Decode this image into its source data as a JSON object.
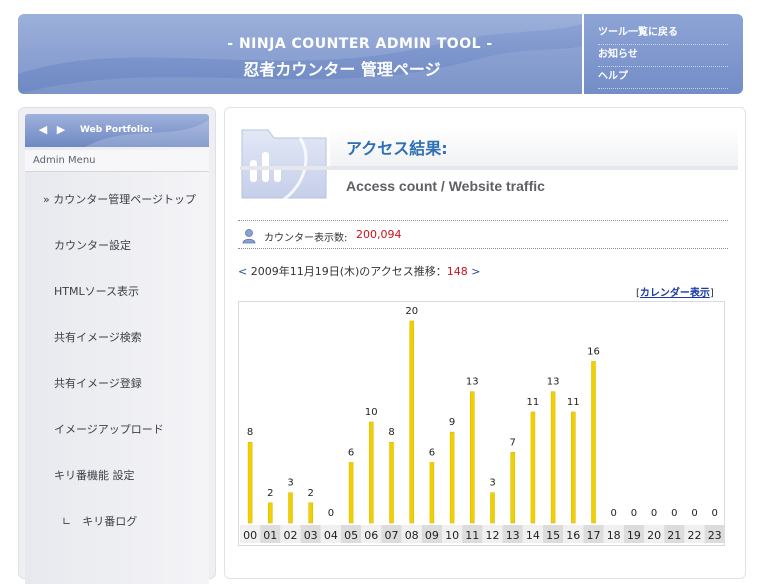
{
  "header": {
    "title_en": "- NINJA COUNTER ADMIN TOOL -",
    "title_jp": "忍者カウンター 管理ページ"
  },
  "topnav": {
    "items": [
      "ツール一覧に戻る",
      "お知らせ",
      "ヘルプ"
    ]
  },
  "sidebar": {
    "head_label": "Web Portfolio:",
    "sub_label": "Admin Menu",
    "items": [
      "» カウンター管理ページトップ",
      "カウンター設定",
      "HTMLソース表示",
      "共有イメージ検索",
      "共有イメージ登録",
      "イメージアップロード",
      "キリ番機能 設定",
      "∟　キリ番ログ"
    ]
  },
  "main": {
    "title": "アクセス結果:",
    "subtitle": "Access count / Website traffic",
    "counter_label": "カウンター表示数:",
    "counter_value": "200,094",
    "date_prev": "<",
    "date_text": " 2009年11月19日(木)のアクセス推移：",
    "date_count": "148",
    "date_next": " >",
    "calendar_open": "[",
    "calendar_link": "カレンダー表示",
    "calendar_close": "]"
  },
  "colors": {
    "bar": "#f2d000",
    "bar_shade": "#d6b400",
    "accent_red": "#d0101b",
    "title_blue": "#2f6fb3"
  },
  "chart_data": {
    "type": "bar",
    "categories": [
      "00",
      "01",
      "02",
      "03",
      "04",
      "05",
      "06",
      "07",
      "08",
      "09",
      "10",
      "11",
      "12",
      "13",
      "14",
      "15",
      "16",
      "17",
      "18",
      "19",
      "20",
      "21",
      "22",
      "23"
    ],
    "values": [
      8,
      2,
      3,
      2,
      0,
      6,
      10,
      8,
      20,
      6,
      9,
      13,
      3,
      7,
      11,
      13,
      11,
      16,
      0,
      0,
      0,
      0,
      0,
      0
    ],
    "ylim": [
      0,
      22
    ]
  }
}
